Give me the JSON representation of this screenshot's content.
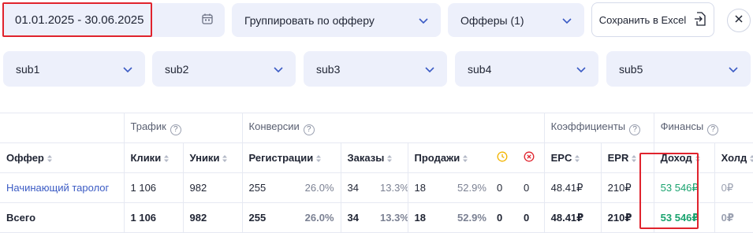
{
  "filters": {
    "date_range": "01.01.2025 - 30.06.2025",
    "group_by": "Группировать по офферу",
    "offers": "Офферы (1)",
    "export_label": "Сохранить в Excel",
    "subs": [
      "sub1",
      "sub2",
      "sub3",
      "sub4",
      "sub5"
    ]
  },
  "table": {
    "groups": {
      "traffic": "Трафик",
      "conversions": "Конверсии",
      "coefficients": "Коэффициенты",
      "finance": "Финансы"
    },
    "columns": {
      "offer": "Оффер",
      "clicks": "Клики",
      "uniques": "Уники",
      "registrations": "Регистрации",
      "orders": "Заказы",
      "sales": "Продажи",
      "epc": "EPC",
      "epr": "EPR",
      "income": "Доход",
      "hold": "Холд"
    },
    "rows": [
      {
        "offer": "Начинающий таролог",
        "clicks": "1 106",
        "uniques": "982",
        "reg": "255",
        "reg_pct": "26.0%",
        "orders": "34",
        "orders_pct": "13.3%",
        "sales": "18",
        "sales_pct": "52.9%",
        "pending": "0",
        "rejected": "0",
        "epc": "48.41₽",
        "epr": "210₽",
        "income": "53 546₽",
        "hold": "0₽"
      }
    ],
    "total": {
      "label": "Всего",
      "clicks": "1 106",
      "uniques": "982",
      "reg": "255",
      "reg_pct": "26.0%",
      "orders": "34",
      "orders_pct": "13.3%",
      "sales": "18",
      "sales_pct": "52.9%",
      "pending": "0",
      "rejected": "0",
      "epc": "48.41₽",
      "epr": "210₽",
      "income": "53 546₽",
      "hold": "0₽"
    }
  },
  "colors": {
    "accent_green": "#1aa36f",
    "highlight_red": "#e0232d",
    "field_bg": "#edf0fb",
    "clock_yellow": "#f2b400",
    "reject_red": "#e0232d"
  }
}
